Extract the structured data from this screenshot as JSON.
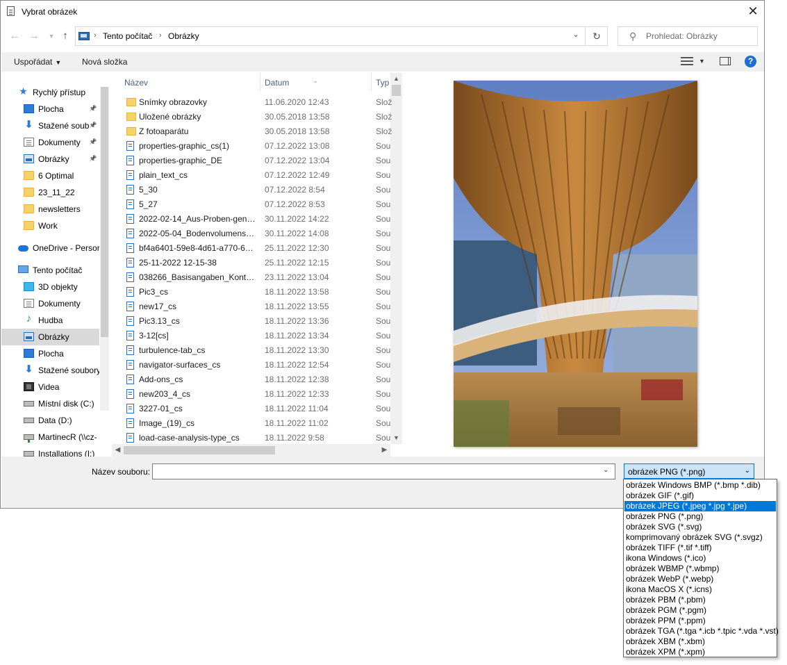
{
  "window": {
    "title": "Vybrat obrázek"
  },
  "address": {
    "crumbs": [
      "Tento počítač",
      "Obrázky"
    ],
    "search_placeholder": "Prohledat: Obrázky"
  },
  "toolbar": {
    "organize": "Uspořádat",
    "new_folder": "Nová složka"
  },
  "nav": {
    "items": [
      {
        "label": "Rychlý přístup",
        "icon": "star-icon",
        "pinned": false,
        "indent": 1
      },
      {
        "label": "Plocha",
        "icon": "desktop-icon",
        "pinned": true,
        "indent": 2
      },
      {
        "label": "Stažené soub",
        "icon": "download-icon",
        "pinned": true,
        "indent": 2
      },
      {
        "label": "Dokumenty",
        "icon": "document-icon",
        "pinned": true,
        "indent": 2
      },
      {
        "label": "Obrázky",
        "icon": "pictures-icon",
        "pinned": true,
        "indent": 2
      },
      {
        "label": "6 Optimal",
        "icon": "folder-icon",
        "pinned": false,
        "indent": 2
      },
      {
        "label": "23_11_22",
        "icon": "folder-icon",
        "pinned": false,
        "indent": 2
      },
      {
        "label": "newsletters",
        "icon": "folder-icon",
        "pinned": false,
        "indent": 2
      },
      {
        "label": "Work",
        "icon": "folder-icon",
        "pinned": false,
        "indent": 2
      },
      {
        "label": "OneDrive - Persor",
        "icon": "onedrive-icon",
        "pinned": false,
        "indent": 1
      },
      {
        "label": "Tento počítač",
        "icon": "computer-icon",
        "pinned": false,
        "indent": 1
      },
      {
        "label": "3D objekty",
        "icon": "3d-objects-icon",
        "pinned": false,
        "indent": 2
      },
      {
        "label": "Dokumenty",
        "icon": "document-icon",
        "pinned": false,
        "indent": 2
      },
      {
        "label": "Hudba",
        "icon": "music-icon",
        "pinned": false,
        "indent": 2
      },
      {
        "label": "Obrázky",
        "icon": "pictures-icon",
        "pinned": false,
        "indent": 2,
        "selected": true
      },
      {
        "label": "Plocha",
        "icon": "desktop-icon",
        "pinned": false,
        "indent": 2
      },
      {
        "label": "Stažené soubory",
        "icon": "download-icon",
        "pinned": false,
        "indent": 2
      },
      {
        "label": "Videa",
        "icon": "video-icon",
        "pinned": false,
        "indent": 2
      },
      {
        "label": "Místní disk (C:)",
        "icon": "disk-icon",
        "pinned": false,
        "indent": 2
      },
      {
        "label": "Data (D:)",
        "icon": "disk-icon",
        "pinned": false,
        "indent": 2
      },
      {
        "label": "MartinecR (\\\\cz-",
        "icon": "network-drive-icon",
        "pinned": false,
        "indent": 2
      },
      {
        "label": "Installations (I:)",
        "icon": "network-drive-icon",
        "pinned": false,
        "indent": 2
      }
    ]
  },
  "files": {
    "columns": {
      "name": "Název",
      "date": "Datum",
      "type": "Typ"
    },
    "rows": [
      {
        "name": "Snímky obrazovky",
        "date": "11.06.2020 12:43",
        "type": "Slož",
        "kind": "folder"
      },
      {
        "name": "Uložené obrázky",
        "date": "30.05.2018 13:58",
        "type": "Slož",
        "kind": "folder"
      },
      {
        "name": "Z fotoaparátu",
        "date": "30.05.2018 13:58",
        "type": "Slož",
        "kind": "folder"
      },
      {
        "name": "properties-graphic_cs(1)",
        "date": "07.12.2022 13:08",
        "type": "Sou",
        "kind": "file"
      },
      {
        "name": "properties-graphic_DE",
        "date": "07.12.2022 13:04",
        "type": "Sou",
        "kind": "file"
      },
      {
        "name": "plain_text_cs",
        "date": "07.12.2022 12:49",
        "type": "Sou",
        "kind": "file"
      },
      {
        "name": "5_30",
        "date": "07.12.2022 8:54",
        "type": "Sou",
        "kind": "file"
      },
      {
        "name": "5_27",
        "date": "07.12.2022 8:53",
        "type": "Sou",
        "kind": "file"
      },
      {
        "name": "2022-02-14_Aus-Proben-gene...",
        "date": "30.11.2022 14:22",
        "type": "Sou",
        "kind": "file"
      },
      {
        "name": "2022-05-04_Bodenvolumensa...",
        "date": "30.11.2022 14:08",
        "type": "Sou",
        "kind": "file"
      },
      {
        "name": "bf4a6401-59e8-4d61-a770-634...",
        "date": "25.11.2022 12:30",
        "type": "Sou",
        "kind": "file"
      },
      {
        "name": "25-11-2022 12-15-38",
        "date": "25.11.2022 12:15",
        "type": "Sou",
        "kind": "file"
      },
      {
        "name": "038266_Basisangaben_Kontex...",
        "date": "23.11.2022 13:04",
        "type": "Sou",
        "kind": "file"
      },
      {
        "name": "Pic3_cs",
        "date": "18.11.2022 13:58",
        "type": "Sou",
        "kind": "file"
      },
      {
        "name": "new17_cs",
        "date": "18.11.2022 13:55",
        "type": "Sou",
        "kind": "file"
      },
      {
        "name": "Pic3.13_cs",
        "date": "18.11.2022 13:36",
        "type": "Sou",
        "kind": "file"
      },
      {
        "name": "3-12[cs]",
        "date": "18.11.2022 13:34",
        "type": "Sou",
        "kind": "file"
      },
      {
        "name": "turbulence-tab_cs",
        "date": "18.11.2022 13:30",
        "type": "Sou",
        "kind": "file"
      },
      {
        "name": "navigator-surfaces_cs",
        "date": "18.11.2022 12:54",
        "type": "Sou",
        "kind": "file"
      },
      {
        "name": "Add-ons_cs",
        "date": "18.11.2022 12:38",
        "type": "Sou",
        "kind": "file"
      },
      {
        "name": "new203_4_cs",
        "date": "18.11.2022 12:33",
        "type": "Sou",
        "kind": "file"
      },
      {
        "name": "3227-01_cs",
        "date": "18.11.2022 11:04",
        "type": "Sou",
        "kind": "file"
      },
      {
        "name": "Image_(19)_cs",
        "date": "18.11.2022 11:02",
        "type": "Sou",
        "kind": "file"
      },
      {
        "name": "load-case-analysis-type_cs",
        "date": "18.11.2022 9:58",
        "type": "Sou",
        "kind": "file"
      }
    ]
  },
  "bottom": {
    "filename_label": "Název souboru:",
    "filename_value": "",
    "filetype_selected": "obrázek PNG (*.png)"
  },
  "filetype_options": {
    "highlighted_index": 2,
    "items": [
      "obrázek Windows BMP (*.bmp *.dib)",
      "obrázek GIF (*.gif)",
      "obrázek JPEG (*.jpeg *.jpg *.jpe)",
      "obrázek PNG (*.png)",
      "obrázek SVG (*.svg)",
      "komprimovaný obrázek SVG (*.svgz)",
      "obrázek TIFF (*.tif *.tiff)",
      "ikona Windows (*.ico)",
      "obrázek WBMP (*.wbmp)",
      "obrázek WebP (*.webp)",
      "ikona MacOS X (*.icns)",
      "obrázek PBM (*.pbm)",
      "obrázek PGM (*.pgm)",
      "obrázek PPM (*.ppm)",
      "obrázek TGA (*.tga *.icb *.tpic *.vda *.vst)",
      "obrázek XBM (*.xbm)",
      "obrázek XPM (*.xpm)"
    ]
  },
  "colors": {
    "accent": "#0078d7",
    "selection": "#cce4f7",
    "folder": "#f6d26b"
  }
}
